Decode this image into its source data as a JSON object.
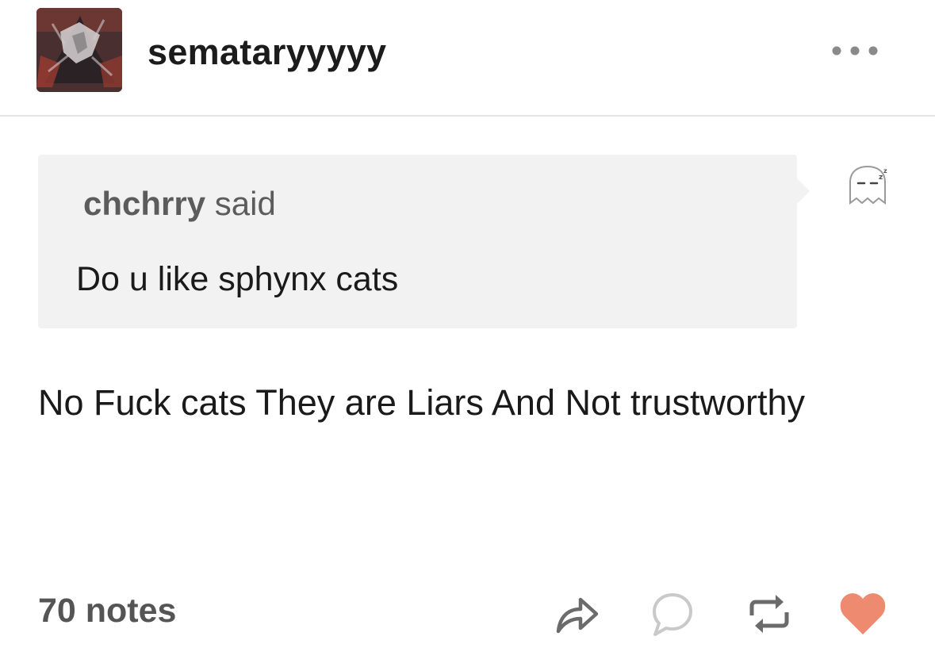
{
  "post": {
    "blog_name": "sematary​yyyy",
    "ask": {
      "asker": "chchrry",
      "said": "said",
      "question": "Do u like sphynx cats"
    },
    "answer": "No Fuck cats They are Liars And Not trustworthy",
    "notes_label": "70 notes"
  },
  "icons": {
    "avatar": "blog-avatar",
    "more": "more-options-icon",
    "anon": "anonymous-ghost-icon",
    "share": "share-icon",
    "reply": "reply-icon",
    "reblog": "reblog-icon",
    "like": "heart-icon"
  },
  "colors": {
    "like": "#ee8a6f",
    "icon_gray": "#6b6b6b",
    "ask_background": "#f2f2f2"
  }
}
